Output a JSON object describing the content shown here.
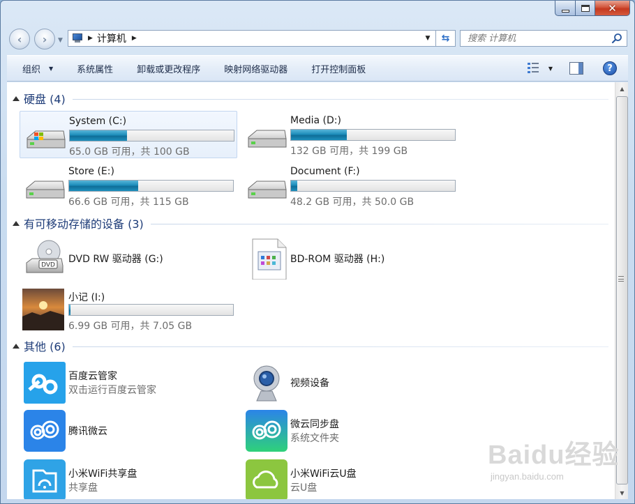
{
  "window": {
    "min_glyph": "_",
    "max_glyph": "□",
    "close_glyph": "✕"
  },
  "nav": {
    "back_glyph": "‹",
    "fwd_glyph": "›",
    "breadcrumb": "计算机",
    "search_placeholder": "搜索 计算机"
  },
  "toolbar": {
    "organize": "组织",
    "properties": "系统属性",
    "uninstall": "卸载或更改程序",
    "map_drive": "映射网络驱动器",
    "control_panel": "打开控制面板",
    "help_glyph": "?"
  },
  "groups": {
    "hard_disks": "硬盘 (4)",
    "removable": "有可移动存储的设备 (3)",
    "other": "其他 (6)"
  },
  "drives": [
    {
      "name": "System (C:)",
      "free": "65.0 GB 可用，共 100 GB",
      "used_fraction": 0.35
    },
    {
      "name": "Media (D:)",
      "free": "132 GB 可用，共 199 GB",
      "used_fraction": 0.34
    },
    {
      "name": "Store (E:)",
      "free": "66.6 GB 可用，共 115 GB",
      "used_fraction": 0.42
    },
    {
      "name": "Document (F:)",
      "free": "48.2 GB 可用，共 50.0 GB",
      "used_fraction": 0.04
    }
  ],
  "removable": [
    {
      "name": "DVD RW 驱动器 (G:)"
    },
    {
      "name": "BD-ROM 驱动器 (H:)"
    },
    {
      "name": "小记 (I:)",
      "free": "6.99 GB 可用，共 7.05 GB",
      "used_fraction": 0.01
    }
  ],
  "other": [
    {
      "name": "百度云管家",
      "sub": "双击运行百度云管家"
    },
    {
      "name": "视频设备",
      "sub": ""
    },
    {
      "name": "腾讯微云",
      "sub": ""
    },
    {
      "name": "微云同步盘",
      "sub": "系统文件夹"
    },
    {
      "name": "小米WiFi共享盘",
      "sub": "共享盘"
    },
    {
      "name": "小米WiFi云U盘",
      "sub": "云U盘"
    }
  ],
  "watermark": {
    "brand": "Baidu经验",
    "url": "jingyan.baidu.com"
  },
  "colors": {
    "accent": "#1e3c78",
    "progress": "#1c8cba",
    "selection": "#e7f0fb"
  }
}
